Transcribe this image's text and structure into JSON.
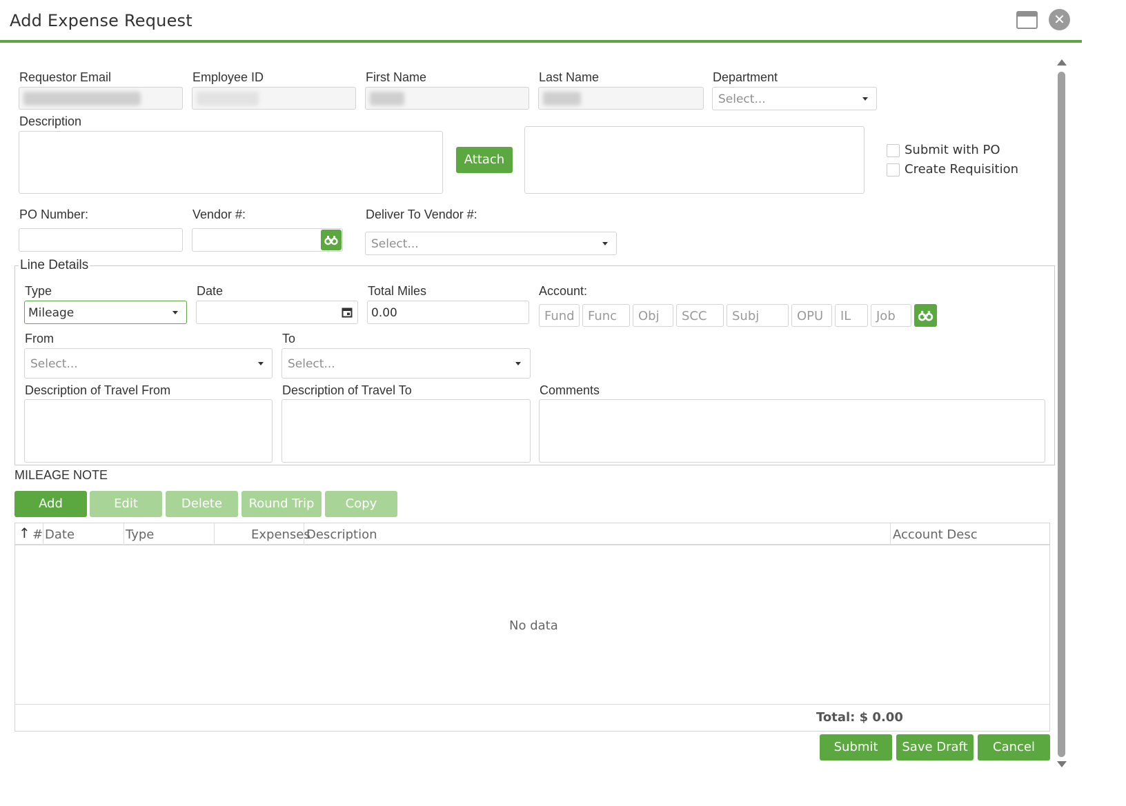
{
  "window": {
    "title": "Add Expense Request",
    "maximize_icon": "window-maximize-icon",
    "close_icon": "close-circle-icon",
    "close_glyph": "✕"
  },
  "header_fields": {
    "requestor_email_label": "Requestor Email",
    "employee_id_label": "Employee ID",
    "first_name_label": "First Name",
    "last_name_label": "Last Name",
    "department_label": "Department",
    "department_placeholder": "Select..."
  },
  "description": {
    "label": "Description",
    "attach_label": "Attach"
  },
  "options": {
    "submit_with_po": "Submit with PO",
    "create_requisition": "Create Requisition"
  },
  "po": {
    "po_number_label": "PO Number:",
    "vendor_label": "Vendor #:",
    "deliver_to_label": "Deliver To Vendor #:",
    "deliver_to_placeholder": "Select...",
    "search_icon": "binoculars-icon"
  },
  "line_details": {
    "legend": "Line Details",
    "type_label": "Type",
    "type_value": "Mileage",
    "date_label": "Date",
    "calendar_icon": "calendar-icon",
    "total_miles_label": "Total Miles",
    "total_miles_value": "0.00",
    "account_label": "Account:",
    "account_fields": [
      "Fund",
      "Func",
      "Obj",
      "SCC",
      "Subj",
      "OPU",
      "IL",
      "Job"
    ],
    "from_label": "From",
    "from_placeholder": "Select...",
    "to_label": "To",
    "to_placeholder": "Select...",
    "travel_from_label": "Description of Travel From",
    "travel_to_label": "Description of Travel To",
    "comments_label": "Comments"
  },
  "mileage_note": "MILEAGE NOTE",
  "actions": {
    "add": "Add",
    "edit": "Edit",
    "delete": "Delete",
    "round_trip": "Round Trip",
    "copy": "Copy"
  },
  "grid": {
    "sort_glyph": "↑",
    "columns": [
      "#",
      "Date",
      "Type",
      "Expenses",
      "Description",
      "Account Desc"
    ],
    "empty_text": "No data",
    "total_text": "Total: $ 0.00"
  },
  "footer": {
    "submit": "Submit",
    "save_draft": "Save Draft",
    "cancel": "Cancel"
  },
  "colors": {
    "accent": "#5aa83f",
    "accent_disabled": "#a8d597"
  }
}
